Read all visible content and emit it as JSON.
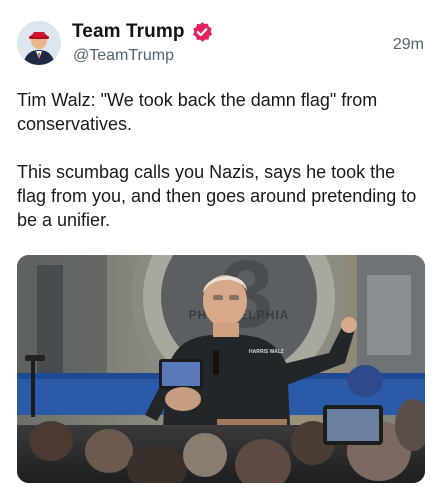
{
  "post": {
    "author": {
      "display_name": "Team Trump",
      "handle": "@TeamTrump",
      "verified": true,
      "verified_badge_color": "#e0245e"
    },
    "timestamp": "29m",
    "paragraphs": [
      "Tim Walz: \"We took back the damn flag\" from conservatives.",
      "This scumbag calls you Nazis, says he took the flag from you, and then goes around pretending to be a unifier."
    ],
    "media": {
      "background_sign_text": "PHILADELPHIA",
      "background_sign_number": "3",
      "shirt_text": "HARRIS WALZ"
    }
  },
  "colors": {
    "text_primary": "#0f1419",
    "text_secondary": "#536471",
    "accent_verified": "#e0245e"
  }
}
